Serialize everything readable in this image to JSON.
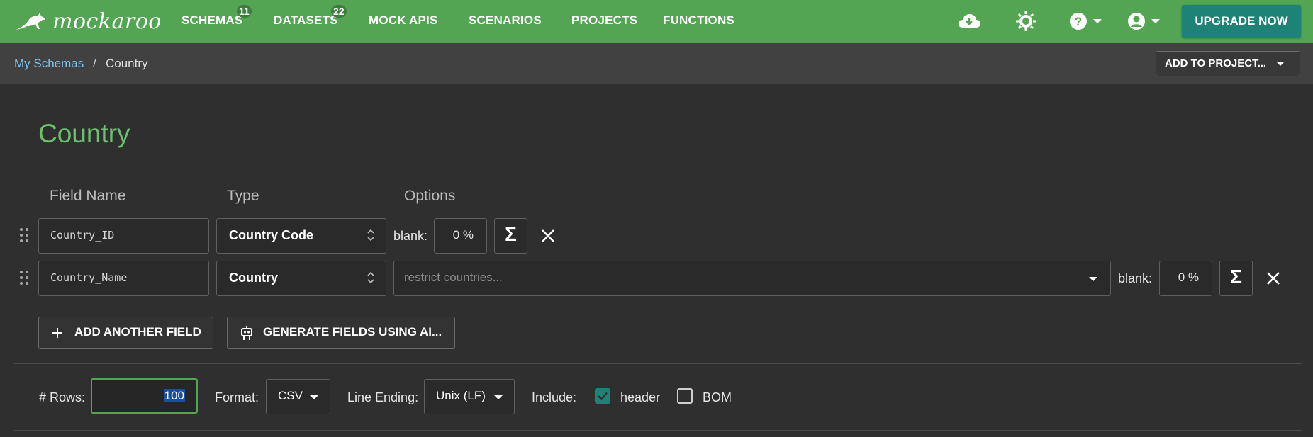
{
  "brand": {
    "name": "mockaroo"
  },
  "nav": {
    "items": [
      {
        "label": "SCHEMAS",
        "badge": "11"
      },
      {
        "label": "DATASETS",
        "badge": "22"
      },
      {
        "label": "MOCK APIS"
      },
      {
        "label": "SCENARIOS"
      },
      {
        "label": "PROJECTS"
      },
      {
        "label": "FUNCTIONS"
      }
    ],
    "icons": [
      "cloud-download-icon",
      "brightness-icon",
      "help-icon",
      "account-icon"
    ],
    "upgrade_label": "UPGRADE NOW"
  },
  "breadcrumb": {
    "parent": "My Schemas",
    "separator": "/",
    "current": "Country"
  },
  "add_to_project_label": "ADD TO PROJECT...",
  "schema": {
    "title": "Country",
    "columns": {
      "field_name": "Field Name",
      "type": "Type",
      "options": "Options"
    },
    "fields": [
      {
        "name": "Country_ID",
        "type": "Country Code",
        "blank_label": "blank:",
        "blank_value": "0 %"
      },
      {
        "name": "Country_Name",
        "type": "Country",
        "restrict_placeholder": "restrict countries...",
        "blank_label": "blank:",
        "blank_value": "0 %"
      }
    ],
    "sigma_symbol": "Σ",
    "add_field_label": "ADD ANOTHER FIELD",
    "generate_ai_label": "GENERATE FIELDS USING AI..."
  },
  "output": {
    "rows_label": "# Rows:",
    "rows_value": "100",
    "format_label": "Format:",
    "format_value": "CSV",
    "line_ending_label": "Line Ending:",
    "line_ending_value": "Unix (LF)",
    "include_label": "Include:",
    "header_label": "header",
    "header_checked": true,
    "bom_label": "BOM",
    "bom_checked": false
  },
  "colors": {
    "nav_green": "#53a553",
    "upgrade_teal": "#1f8276",
    "title_green": "#6fbf6f",
    "link_blue": "#7cc4f0"
  }
}
